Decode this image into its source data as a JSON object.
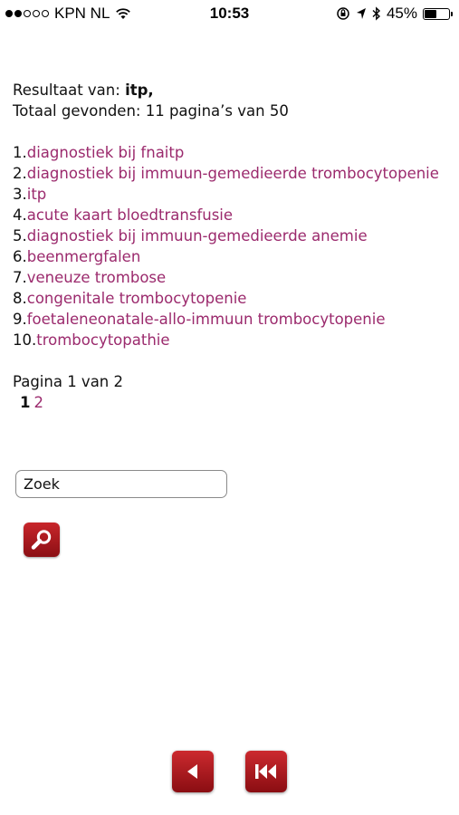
{
  "status_bar": {
    "carrier": "KPN NL",
    "time": "10:53",
    "battery": "45%",
    "battery_level": 0.45,
    "signal_filled": 2,
    "signal_total": 5
  },
  "results": {
    "label_prefix": "Resultaat van: ",
    "query": "itp,",
    "total_text": "Totaal gevonden: 11 pagina’s van 50",
    "items": [
      {
        "num": "1.",
        "title": "diagnostiek bij fnaitp"
      },
      {
        "num": "2.",
        "title": "diagnostiek bij immuun-gemedieerde trombocytopenie"
      },
      {
        "num": "3.",
        "title": "itp"
      },
      {
        "num": "4.",
        "title": "acute kaart bloedtransfusie"
      },
      {
        "num": "5.",
        "title": "diagnostiek bij immuun-gemedieerde anemie"
      },
      {
        "num": "6.",
        "title": "beenmergfalen"
      },
      {
        "num": "7.",
        "title": "veneuze trombose"
      },
      {
        "num": "8.",
        "title": "congenitale trombocytopenie"
      },
      {
        "num": "9.",
        "title": "foetaleneonatale-allo-immuun trombocytopenie"
      },
      {
        "num": "10.",
        "title": "trombocytopathie"
      }
    ]
  },
  "pagination": {
    "text": "Pagina 1 van 2",
    "current": "1",
    "next": "2"
  },
  "search": {
    "value": "Zoek"
  },
  "colors": {
    "link": "#9b2a6d",
    "button": "#b01b21"
  },
  "icons": {
    "search_button": "magnifier-icon",
    "back_button": "triangle-left-icon",
    "first_button": "skip-to-start-icon"
  }
}
